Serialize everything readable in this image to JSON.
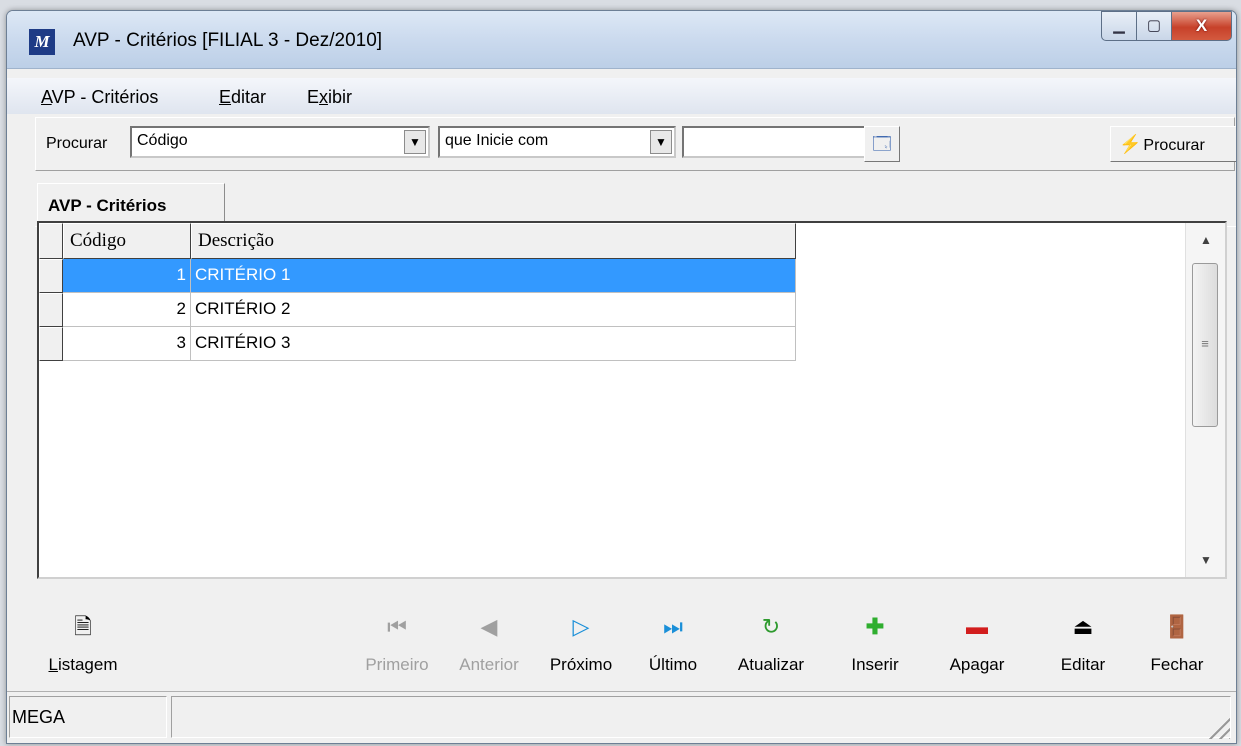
{
  "window": {
    "title": "AVP - Critérios [FILIAL 3 - Dez/2010]",
    "logo_text": "M",
    "controls": {
      "minimize": "▁",
      "maximize": "▢",
      "close": "X"
    }
  },
  "menu": [
    {
      "label": "AVP - Critérios",
      "ul": "A",
      "rest": "VP - Critérios"
    },
    {
      "label": "Editar",
      "ul": "E",
      "rest": "ditar"
    },
    {
      "label": "Exibir",
      "pre": "E",
      "ul": "x",
      "rest": "ibir"
    }
  ],
  "toolbar": {
    "search_label": "Procurar",
    "field_value": "Código",
    "operator_value": "que Inicie com",
    "search_value": "",
    "search_button": "Procurar"
  },
  "tab": {
    "label": "AVP - Critérios"
  },
  "grid": {
    "columns": [
      "Código",
      "Descrição"
    ],
    "rows": [
      {
        "code": "1",
        "desc": "CRITÉRIO 1",
        "selected": true
      },
      {
        "code": "2",
        "desc": "CRITÉRIO 2",
        "selected": false
      },
      {
        "code": "3",
        "desc": "CRITÉRIO 3",
        "selected": false
      }
    ]
  },
  "actions": {
    "listagem": {
      "label": "Listagem",
      "icon": "report-icon"
    },
    "primeiro": {
      "label": "Primeiro",
      "icon": "first-icon",
      "enabled": false
    },
    "anterior": {
      "label": "Anterior",
      "icon": "previous-icon",
      "enabled": false
    },
    "proximo": {
      "label": "Próximo",
      "icon": "next-icon",
      "enabled": true
    },
    "ultimo": {
      "label": "Último",
      "icon": "last-icon",
      "enabled": true
    },
    "atualizar": {
      "label": "Atualizar",
      "icon": "refresh-icon"
    },
    "inserir": {
      "label": "Inserir",
      "icon": "plus-icon"
    },
    "apagar": {
      "label": "Apagar",
      "icon": "minus-icon"
    },
    "editar": {
      "label": "Editar",
      "icon": "eject-icon"
    },
    "fechar": {
      "label": "Fechar",
      "icon": "exit-door-icon"
    }
  },
  "status": {
    "left": "MEGA",
    "right": ""
  },
  "colors": {
    "selection": "#3399ff",
    "refresh": "#2e9a2e",
    "insert": "#2fae2f",
    "delete": "#d21d1d",
    "next": "#1a8fd8"
  }
}
